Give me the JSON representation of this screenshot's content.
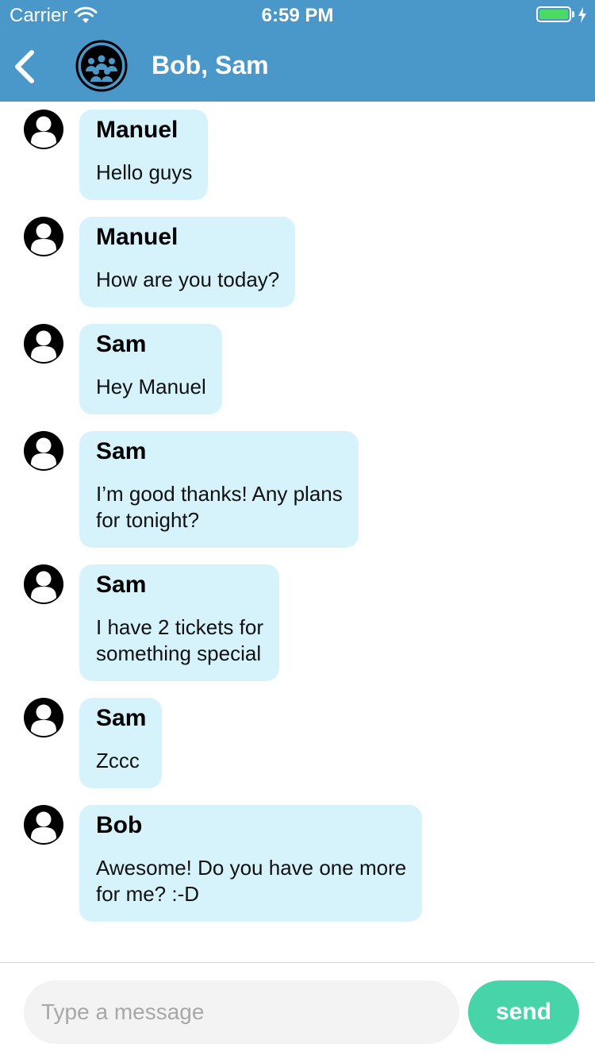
{
  "status_bar": {
    "carrier": "Carrier",
    "time": "6:59 PM",
    "battery_color": "#4cd964"
  },
  "header": {
    "title": "Bob, Sam",
    "back_icon": "chevron-left-icon",
    "group_icon": "group-avatar-icon",
    "background_color": "#4a97c9"
  },
  "messages": [
    {
      "sender": "Manuel",
      "text": "Hello guys"
    },
    {
      "sender": "Manuel",
      "text": "How are you today?"
    },
    {
      "sender": "Sam",
      "text": "Hey Manuel"
    },
    {
      "sender": "Sam",
      "text": "I’m good thanks! Any plans\nfor tonight?"
    },
    {
      "sender": "Sam",
      "text": "I have 2 tickets for\nsomething special"
    },
    {
      "sender": "Sam",
      "text": "Zccc"
    },
    {
      "sender": "Bob",
      "text": "Awesome! Do you have one more\nfor me? :-D"
    }
  ],
  "colors": {
    "bubble": "#d6f3fc",
    "send_button": "#47d4a8"
  },
  "composer": {
    "placeholder": "Type a message",
    "value": "",
    "send_label": "send"
  }
}
